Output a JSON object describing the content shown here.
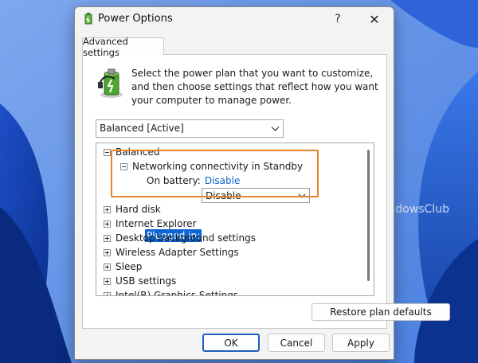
{
  "window": {
    "title": "Power Options",
    "help_label": "?",
    "close_label": "✕"
  },
  "tabs": [
    "Advanced settings"
  ],
  "intro_text": "Select the power plan that you want to customize, and then choose settings that reflect how you want your computer to manage power.",
  "plan_select": {
    "value": "Balanced [Active]"
  },
  "tree": {
    "root": "Balanced",
    "expanded_group": {
      "label": "Networking connectivity in Standby",
      "on_battery_label": "On battery:",
      "on_battery_value": "Disable",
      "plugged_in_label": "Plugged in:",
      "plugged_in_value": "Disable"
    },
    "items": [
      "Hard disk",
      "Internet Explorer",
      "Desktop background settings",
      "Wireless Adapter Settings",
      "Sleep",
      "USB settings",
      "Intel(R) Graphics Settings"
    ]
  },
  "buttons": {
    "restore": "Restore plan defaults",
    "ok": "OK",
    "cancel": "Cancel",
    "apply": "Apply"
  },
  "watermark": "TheWindowsClub",
  "colors": {
    "accent": "#0a64d2",
    "highlight_border": "#e8832a",
    "link": "#0a64c8"
  }
}
